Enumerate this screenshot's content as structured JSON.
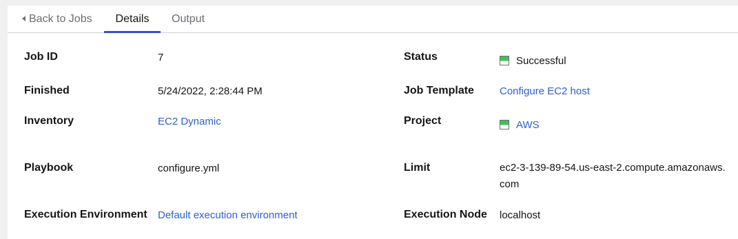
{
  "tabs": {
    "back": "Back to Jobs",
    "details": "Details",
    "output": "Output"
  },
  "details": {
    "job_id": {
      "label": "Job ID",
      "value": "7"
    },
    "status": {
      "label": "Status",
      "value": "Successful"
    },
    "finished": {
      "label": "Finished",
      "value": "5/24/2022, 2:28:44 PM"
    },
    "job_template": {
      "label": "Job Template",
      "value": "Configure EC2 host"
    },
    "inventory": {
      "label": "Inventory",
      "value": "EC2 Dynamic"
    },
    "project": {
      "label": "Project",
      "value": "AWS"
    },
    "playbook": {
      "label": "Playbook",
      "value": "configure.yml"
    },
    "limit": {
      "label": "Limit",
      "value": "ec2-3-139-89-54.us-east-2.compute.amazonaws.com"
    },
    "execution_environment": {
      "label": "Execution Environment",
      "value": "Default execution environment"
    },
    "execution_node": {
      "label": "Execution Node",
      "value": "localhost"
    }
  },
  "colors": {
    "link": "#2b5fce",
    "active_tab": "#3551c9",
    "success": "#3ec05b"
  },
  "icons": {
    "status": "success-status-icon",
    "project_status": "project-status-icon"
  }
}
